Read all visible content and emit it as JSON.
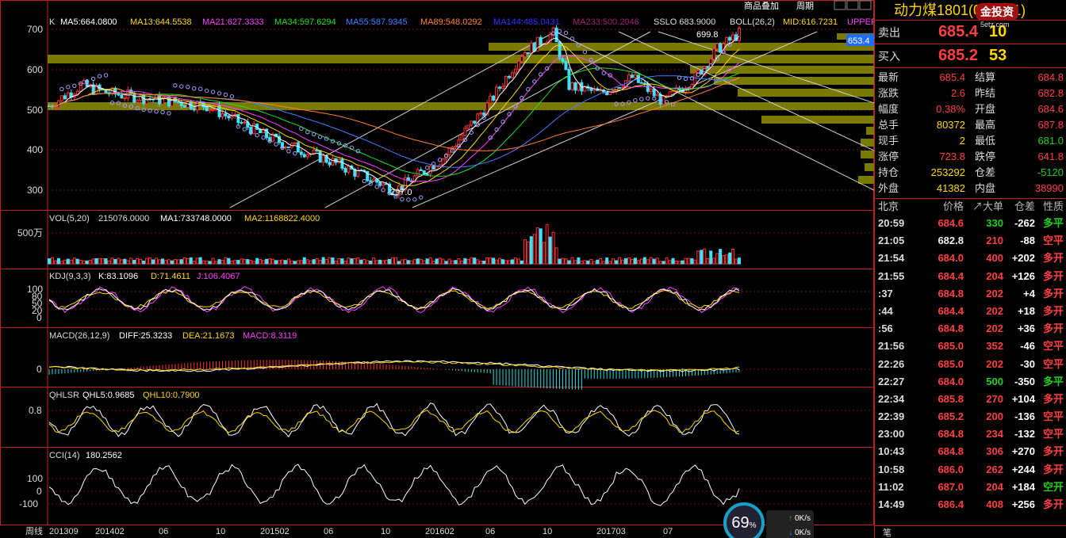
{
  "toolbar": {
    "overlay": "商品叠加",
    "period": "周期"
  },
  "main": {
    "k_label": "K",
    "ma5": "MA5:664.0800",
    "ma13": "MA13:644.5538",
    "ma21": "MA21:627.3333",
    "ma34": "MA34:597.6294",
    "ma55": "MA55:587.9345",
    "ma89": "MA89:548.0292",
    "ma144": "MA144:485.0431",
    "ma233": "MA233:500.2046",
    "sslo": "SSLO  683.9000",
    "boll": "BOLL(26,2)",
    "mid": "MID:616.7231",
    "upper": "UPPER",
    "y_ticks": [
      "700",
      "600",
      "500",
      "400",
      "300"
    ],
    "high_label": "699.8",
    "low_label": "297.0",
    "current_price_tag": "653.4"
  },
  "vol": {
    "title": "VOL(5,20)",
    "value": "215076.0000",
    "ma1": "MA1:733748.0000",
    "ma2": "MA2:1168822.4000",
    "y_tick": "500万"
  },
  "kdj": {
    "title": "KDJ(9,3,3)",
    "k": "K:83.1096",
    "d": "D:71.4611",
    "j": "J:106.4067",
    "y_ticks": [
      "100",
      "80",
      "50",
      "20",
      "0"
    ]
  },
  "macd": {
    "title": "MACD(26,12,9)",
    "diff": "DIFF:25.3233",
    "dea": "DEA:21.1673",
    "macd": "MACD:8.3119",
    "y_tick": "0"
  },
  "qhlsr": {
    "title": "QHLSR",
    "qhl5": "QHL5:0.9685",
    "qhl10": "QHL10:0.7900",
    "y_tick": "0.8"
  },
  "cci": {
    "title": "CCI(14)",
    "value": "180.2562",
    "y_ticks": [
      "100",
      "0",
      "-100"
    ]
  },
  "x_axis": {
    "period_label": "周线",
    "ticks": [
      "201309",
      "201402",
      "06",
      "10",
      "201502",
      "06",
      "10",
      "201602",
      "06",
      "10",
      "201703",
      "07"
    ]
  },
  "quote": {
    "title": "动力煤1801(033301)",
    "sell_label": "卖出",
    "sell_price": "685.4",
    "sell_vol": "10",
    "buy_label": "买入",
    "buy_price": "685.2",
    "buy_vol": "53",
    "stats": [
      {
        "l1": "最新",
        "v1": "685.4",
        "l2": "结算",
        "v2": "684.8"
      },
      {
        "l1": "涨跌",
        "v1": "2.6",
        "l2": "昨结",
        "v2": "682.8"
      },
      {
        "l1": "幅度",
        "v1": "0.38%",
        "l2": "开盘",
        "v2": "684.6"
      },
      {
        "l1": "总手",
        "v1": "80372",
        "l2": "最高",
        "v2": "687.8"
      },
      {
        "l1": "现手",
        "v1": "2",
        "l2": "最低",
        "v2": "681.0"
      },
      {
        "l1": "涨停",
        "v1": "723.8",
        "l2": "跌停",
        "v2": "641.8"
      },
      {
        "l1": "持仓",
        "v1": "253292",
        "l2": "仓差",
        "v2": "-5120"
      },
      {
        "l1": "外盘",
        "v1": "41382",
        "l2": "内盘",
        "v2": "38990"
      }
    ],
    "tick_headers": {
      "time": "北京",
      "price": "价格",
      "vol": "↗大单",
      "diff": "仓差",
      "nature": "性质"
    },
    "ticks": [
      {
        "t": "20:59",
        "p": "684.6",
        "v": "330",
        "d": "-262",
        "n": "多平"
      },
      {
        "t": "21:05",
        "p": "682.8",
        "v": "210",
        "d": "-88",
        "n": "空平"
      },
      {
        "t": "21:54",
        "p": "684.0",
        "v": "400",
        "d": "+202",
        "n": "多开"
      },
      {
        "t": "21:55",
        "p": "684.4",
        "v": "204",
        "d": "+126",
        "n": "多开"
      },
      {
        "t": ":37",
        "p": "684.8",
        "v": "202",
        "d": "+4",
        "n": "多开"
      },
      {
        "t": ":44",
        "p": "684.4",
        "v": "202",
        "d": "+18",
        "n": "多开"
      },
      {
        "t": ":56",
        "p": "684.8",
        "v": "202",
        "d": "+36",
        "n": "多开"
      },
      {
        "t": "21:56",
        "p": "685.0",
        "v": "352",
        "d": "-46",
        "n": "空平"
      },
      {
        "t": "22:26",
        "p": "685.0",
        "v": "202",
        "d": "-30",
        "n": "空平"
      },
      {
        "t": "22:27",
        "p": "684.0",
        "v": "500",
        "d": "-350",
        "n": "多平"
      },
      {
        "t": "22:34",
        "p": "685.8",
        "v": "270",
        "d": "+104",
        "n": "多开"
      },
      {
        "t": "22:39",
        "p": "685.2",
        "v": "200",
        "d": "-136",
        "n": "空平"
      },
      {
        "t": "23:00",
        "p": "684.8",
        "v": "234",
        "d": "-132",
        "n": "空平"
      },
      {
        "t": "10:43",
        "p": "684.8",
        "v": "306",
        "d": "+270",
        "n": "多开"
      },
      {
        "t": "10:58",
        "p": "686.0",
        "v": "262",
        "d": "+244",
        "n": "多开"
      },
      {
        "t": "11:02",
        "p": "687.0",
        "v": "204",
        "d": "+184",
        "n": "空开"
      },
      {
        "t": "14:49",
        "p": "686.4",
        "v": "408",
        "d": "+256",
        "n": "多开"
      }
    ],
    "input_label": "笔"
  },
  "status": {
    "gauge": "69",
    "gauge_unit": "%",
    "up_speed": "0K/s",
    "down_speed": "0K/s"
  },
  "logo": {
    "name": "金投资",
    "site": "5etz.com"
  }
}
